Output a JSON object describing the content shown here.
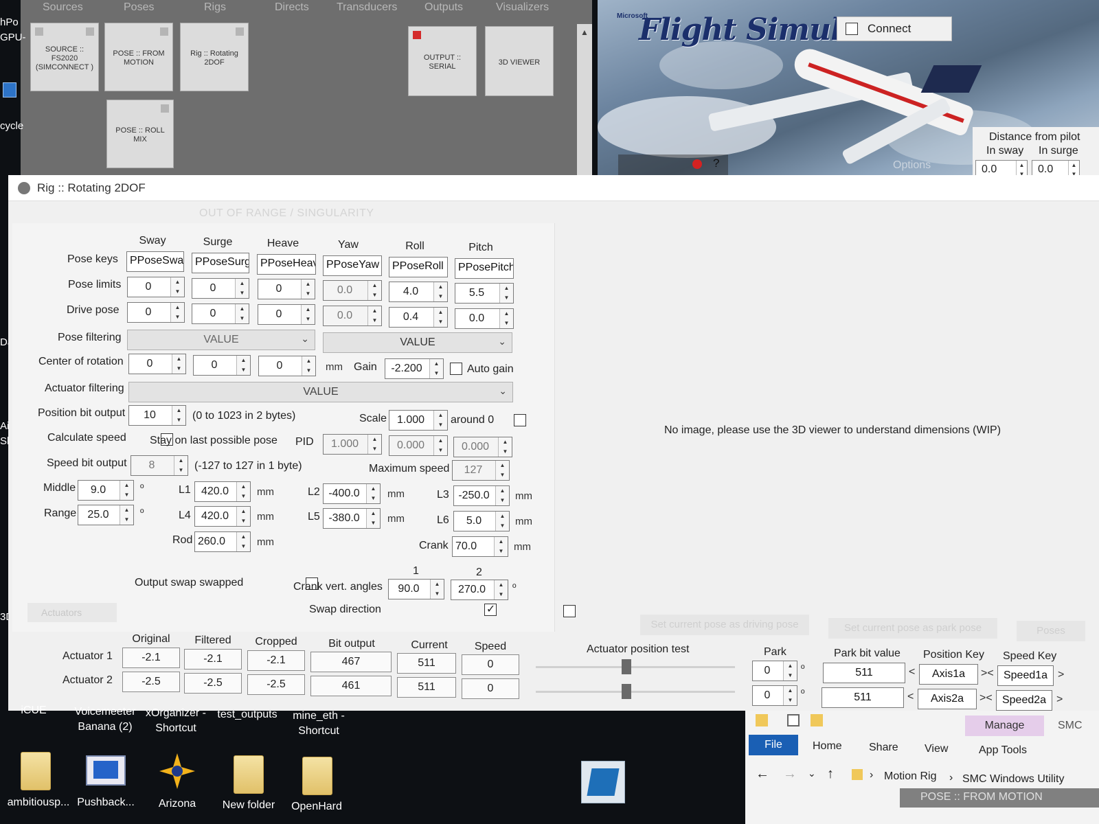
{
  "node_editor": {
    "tabs": [
      "Sources",
      "Poses",
      "Rigs",
      "Directs",
      "Transducers",
      "Outputs",
      "Visualizers"
    ],
    "nodes": {
      "source": "SOURCE :: FS2020 (SIMCONNECT )",
      "pose_from_motion": "POSE :: FROM MOTION",
      "rig": "Rig :: Rotating 2DOF",
      "pose_roll_mix": "POSE :: ROLL MIX",
      "output_serial": "OUTPUT :: SERIAL",
      "viewer_3d": "3D VIEWER"
    }
  },
  "sim": {
    "logo": "Flight Simulator",
    "logo_prefix": "Microsoft",
    "connect_label": "Connect",
    "help": "?",
    "options": "Options",
    "distance_title": "Distance from pilot",
    "in_sway_label": "In sway",
    "in_surge_label": "In surge",
    "in_sway_value": "0.0",
    "in_surge_value": "0.0"
  },
  "desk_left": [
    "hPo",
    "GPU-",
    "cycle",
    "Dar",
    "Air",
    "Sho",
    "3D",
    "S"
  ],
  "rig_window": {
    "title": "Rig :: Rotating 2DOF",
    "out_of_range": "OUT OF RANGE / SINGULARITY",
    "no_image_text": "No image, please use the 3D viewer to understand dimensions (WIP)",
    "axis_headers": [
      "Sway",
      "Surge",
      "Heave",
      "Yaw",
      "Roll",
      "Pitch"
    ],
    "row_labels": {
      "pose_keys": "Pose keys",
      "pose_limits": "Pose limits",
      "drive_pose": "Drive pose",
      "pose_filtering": "Pose filtering",
      "center_of_rotation": "Center of rotation",
      "actuator_filtering": "Actuator filtering",
      "position_bit_output": "Position bit output",
      "calculate_speed": "Calculate speed",
      "speed_bit_output": "Speed bit output",
      "middle": "Middle",
      "range": "Range"
    },
    "pose_keys": [
      "PPoseSway",
      "PPoseSurge",
      "PPoseHeave",
      "PPoseYaw",
      "PPoseRoll",
      "PPosePitch"
    ],
    "pose_limits": [
      "0",
      "0",
      "0",
      "0.0",
      "4.0",
      "5.5"
    ],
    "drive_pose": [
      "0",
      "0",
      "0",
      "0.0",
      "0.4",
      "0.0"
    ],
    "pose_filtering": [
      "VALUE",
      "VALUE"
    ],
    "center_of_rotation": [
      "0",
      "0",
      "0"
    ],
    "mm": "mm",
    "gain_label": "Gain",
    "gain_value": "-2.200",
    "auto_gain_label": "Auto gain",
    "actuator_filtering": "VALUE",
    "position_bit_output": "10",
    "position_bit_desc": "(0 to 1023 in 2 bytes)",
    "scale_label": "Scale",
    "scale_value": "1.000",
    "around_zero_label": "around 0",
    "stay_last_pose_label": "Stay on last possible pose",
    "pid_label": "PID",
    "pid_values": [
      "1.000",
      "0.000",
      "0.000"
    ],
    "speed_bit_output": "8",
    "speed_bit_desc": "(-127 to 127 in 1 byte)",
    "max_speed_label": "Maximum speed",
    "max_speed_value": "127",
    "middle_value": "9.0",
    "range_value": "25.0",
    "degree": "º",
    "l1_label": "L1",
    "l1_value": "420.0",
    "l2_label": "L2",
    "l2_value": "-400.0",
    "l3_label": "L3",
    "l3_value": "-250.0",
    "l4_label": "L4",
    "l4_value": "420.0",
    "l5_label": "L5",
    "l5_value": "-380.0",
    "l6_label": "L6",
    "l6_value": "5.0",
    "rod_label": "Rod",
    "rod_value": "260.0",
    "crank_label": "Crank",
    "crank_value": "70.0",
    "col1": "1",
    "col2": "2",
    "output_swap_label": "Output swap swapped",
    "crank_vert_label": "Crank vert. angles",
    "crank_angle_1": "90.0",
    "crank_angle_2": "270.0",
    "swap_direction_label": "Swap direction",
    "actuators_section": "Actuators"
  },
  "actuators": {
    "headers": [
      "Original",
      "Filtered",
      "Cropped",
      "Bit output",
      "Current",
      "Speed"
    ],
    "rows": [
      {
        "name": "Actuator 1",
        "cells": [
          "-2.1",
          "-2.1",
          "-2.1",
          "467",
          "511",
          "0"
        ],
        "park": "0",
        "park_bit": "511",
        "position_key": "Axis1a",
        "speed_key": "Speed1a"
      },
      {
        "name": "Actuator 2",
        "cells": [
          "-2.5",
          "-2.5",
          "-2.5",
          "461",
          "511",
          "0"
        ],
        "park": "0",
        "park_bit": "511",
        "position_key": "Axis2a",
        "speed_key": "Speed2a"
      }
    ],
    "position_test_label": "Actuator position test",
    "park_label": "Park",
    "park_bit_label": "Park bit value",
    "position_key_label": "Position Key",
    "speed_key_label": "Speed Key",
    "set_driving_pose": "Set current pose as driving pose",
    "set_park_pose": "Set current pose as park pose",
    "poses_btn": "Poses"
  },
  "desktop": {
    "row1": [
      {
        "label": "iCUE"
      },
      {
        "label": "Voicemeeter Banana (2)"
      },
      {
        "label": "xOrganizer - Shortcut"
      },
      {
        "label": "test_outputs"
      },
      {
        "label": "mine_eth - Shortcut"
      }
    ],
    "row2": [
      {
        "label": "ambitiousp..."
      },
      {
        "label": "Pushback..."
      },
      {
        "label": "Arizona"
      },
      {
        "label": "New folder"
      },
      {
        "label": "OpenHard"
      }
    ]
  },
  "explorer": {
    "manage": "Manage",
    "smc": "SMC",
    "tabs": [
      "File",
      "Home",
      "Share",
      "View",
      "App Tools"
    ],
    "path": [
      "Motion Rig",
      "SMC Windows Utility"
    ],
    "status": "POSE :: FROM MOTION"
  },
  "colors": {
    "desktop_bg": "#0d1014",
    "window_bg": "#f0f0f0",
    "file_tab": "#1a5fb4",
    "manage_tab": "#e5cdea",
    "red_indicator": "#d42a2a"
  }
}
